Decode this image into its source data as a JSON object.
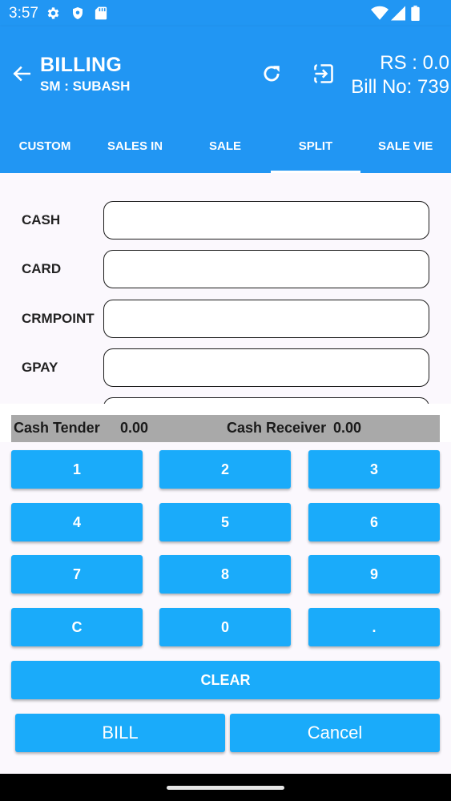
{
  "status_bar": {
    "time": "3:57",
    "icons": [
      "gear-icon",
      "shield-icon",
      "sd-card-icon",
      "wifi-icon",
      "signal-icon",
      "battery-icon"
    ]
  },
  "app_bar": {
    "title": "BILLING",
    "subtitle": "SM : SUBASH",
    "rs": "RS : 0.0",
    "bill_no": "Bill No: 739",
    "icons": [
      "back-arrow-icon",
      "refresh-icon",
      "exit-icon"
    ]
  },
  "tabs": [
    {
      "label": "CUSTOM"
    },
    {
      "label": "SALES IN"
    },
    {
      "label": "SALE"
    },
    {
      "label": "SPLIT",
      "active": true
    },
    {
      "label": "SALE VIE"
    }
  ],
  "form": {
    "fields": [
      {
        "label": "CASH",
        "value": ""
      },
      {
        "label": "CARD",
        "value": ""
      },
      {
        "label": "CRMPOINT",
        "value": ""
      },
      {
        "label": "GPAY",
        "value": ""
      },
      {
        "label": "",
        "value": ""
      }
    ]
  },
  "summary": {
    "cash_tender_label": "Cash Tender",
    "cash_tender_value": "0.00",
    "cash_receiver_label": "Cash Receiver",
    "cash_receiver_value": "0.00"
  },
  "keypad": {
    "keys": [
      "1",
      "2",
      "3",
      "4",
      "5",
      "6",
      "7",
      "8",
      "9",
      "C",
      "0",
      "."
    ],
    "clear": "CLEAR",
    "bill": "BILL",
    "cancel": "Cancel"
  },
  "colors": {
    "primary": "#2196F3",
    "key": "#1AABFA",
    "summary_bg": "#A9A9A9"
  }
}
